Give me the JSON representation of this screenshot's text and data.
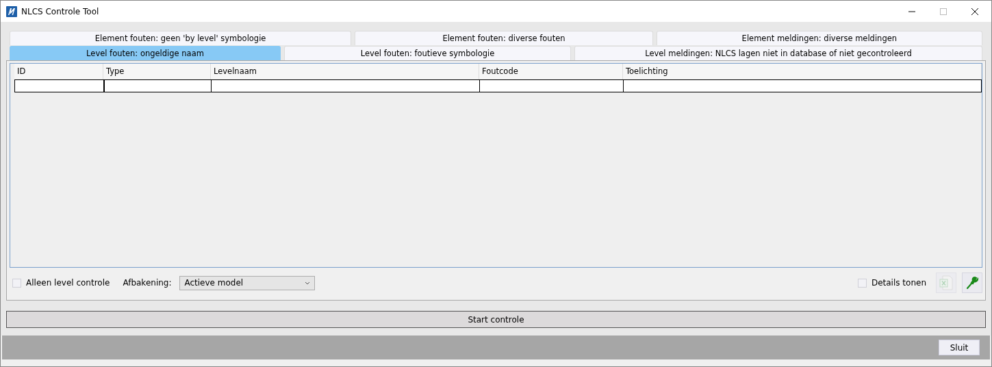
{
  "window": {
    "title": "NLCS Controle Tool"
  },
  "tab_rows": [
    [
      {
        "label": "Element fouten: geen 'by level' symbologie",
        "selected": false
      },
      {
        "label": "Element fouten: diverse fouten",
        "selected": false
      },
      {
        "label": "Element meldingen: diverse meldingen",
        "selected": false
      }
    ],
    [
      {
        "label": "Level fouten: ongeldige naam",
        "selected": true
      },
      {
        "label": "Level fouten: foutieve symbologie",
        "selected": false
      },
      {
        "label": "Level meldingen: NLCS lagen niet in database of niet gecontroleerd",
        "selected": false
      }
    ]
  ],
  "table": {
    "columns": [
      "ID",
      "Type",
      "Levelnaam",
      "Foutcode",
      "Toelichting"
    ]
  },
  "options": {
    "level_only": {
      "label": "Alleen level controle",
      "checked": false
    },
    "scope_label": "Afbakening:",
    "scope": {
      "value": "Actieve model"
    },
    "details": {
      "label": "Details tonen",
      "checked": false
    },
    "excel_export": {
      "disabled": true
    },
    "settings": {
      "disabled": false
    }
  },
  "start_button": "Start controle",
  "close_button": "Sluit"
}
